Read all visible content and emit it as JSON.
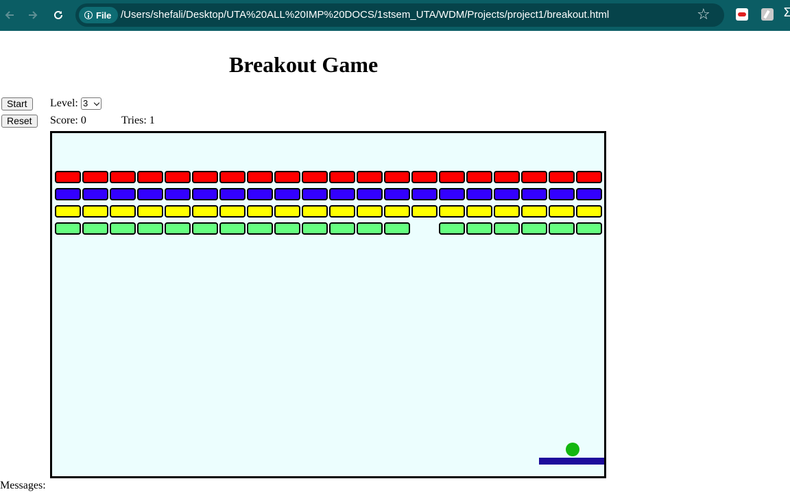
{
  "browser": {
    "file_chip": "File",
    "url": "/Users/shefali/Desktop/UTA%20ALL%20IMP%20DOCS/1stsem_UTA/WDM/Projects/project1/breakout.html"
  },
  "page": {
    "title": "Breakout Game",
    "start_label": "Start",
    "reset_label": "Reset",
    "level_label": "Level:",
    "level_value": "3",
    "score_label": "Score: 0",
    "tries_label": "Tries: 1",
    "messages_label": "Messages:"
  },
  "game": {
    "background": "#ecfefe",
    "bricks_per_row": 20,
    "rows": [
      {
        "color": "#ff0000",
        "missing": []
      },
      {
        "color": "#3300ff",
        "missing": []
      },
      {
        "color": "#ffff00",
        "missing": []
      },
      {
        "color": "#66ff80",
        "missing": [
          13
        ]
      }
    ],
    "ball_color": "#13b70f",
    "paddle_color": "#1e0c9c"
  }
}
